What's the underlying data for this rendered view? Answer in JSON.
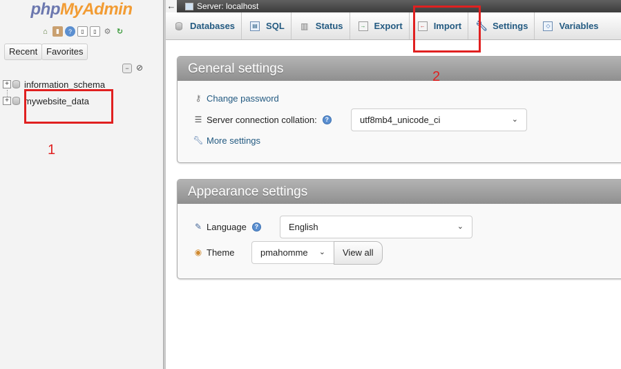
{
  "sidebar": {
    "logo_php": "php",
    "logo_myadmin": "MyAdmin",
    "recent_label": "Recent",
    "favorites_label": "Favorites",
    "databases": [
      {
        "name": "information_schema"
      },
      {
        "name": "mywebsite_data"
      }
    ]
  },
  "topbar": {
    "back_arrow": "←",
    "server_label": "Server: localhost"
  },
  "tabs": [
    {
      "label": "Databases",
      "icon": "database-icon"
    },
    {
      "label": "SQL",
      "icon": "sql-icon"
    },
    {
      "label": "Status",
      "icon": "status-icon"
    },
    {
      "label": "Export",
      "icon": "export-icon"
    },
    {
      "label": "Import",
      "icon": "import-icon"
    },
    {
      "label": "Settings",
      "icon": "wrench-icon"
    },
    {
      "label": "Variables",
      "icon": "variables-icon"
    }
  ],
  "general_settings": {
    "title": "General settings",
    "change_password": "Change password",
    "collation_label": "Server connection collation:",
    "collation_value": "utf8mb4_unicode_ci",
    "more_settings": "More settings"
  },
  "appearance_settings": {
    "title": "Appearance settings",
    "language_label": "Language",
    "language_value": "English",
    "theme_label": "Theme",
    "theme_value": "pmahomme",
    "view_all_label": "View all"
  },
  "annotations": {
    "step1": "1",
    "step2": "2",
    "color": "#e02020"
  },
  "colors": {
    "link": "#235a81",
    "logo_php": "#6c78af",
    "logo_myadmin": "#f29c34"
  }
}
